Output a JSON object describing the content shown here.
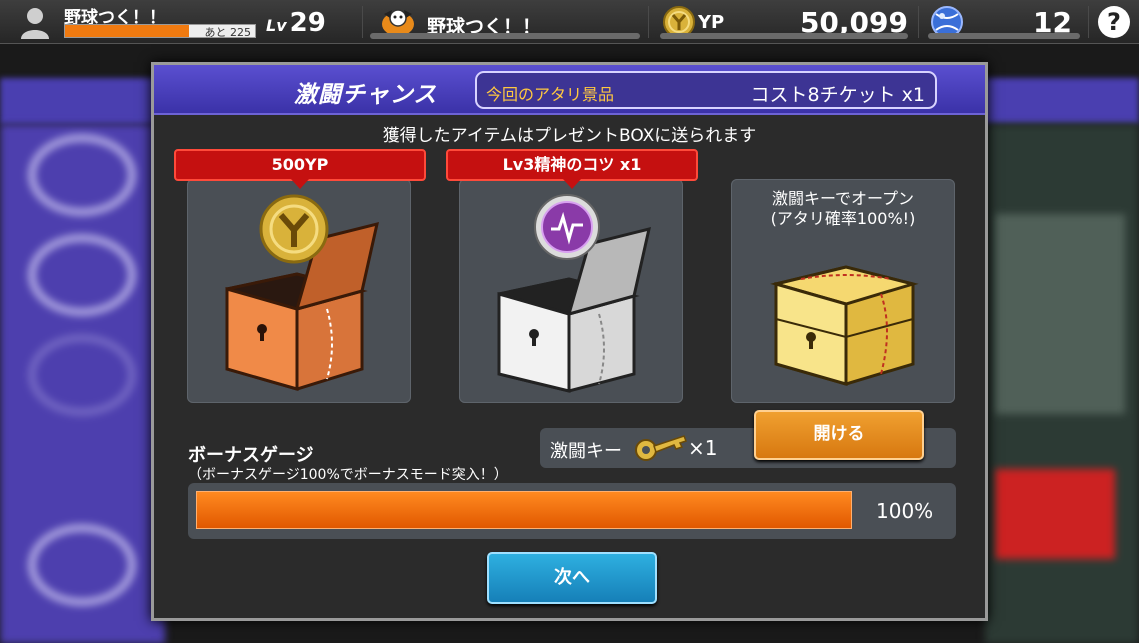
{
  "topbar": {
    "user_name": "野球つく！！",
    "exp_remaining": "あと 225",
    "exp_progress": 0.65,
    "level_prefix": "Lv",
    "level": "29",
    "team_name": "野球つく！！",
    "currency_label": "YP",
    "currency_value": "50,099",
    "ball_count": "12",
    "help_label": "?"
  },
  "modal": {
    "title": "激闘チャンス",
    "prize_label": "今回のアタリ景品",
    "prize_value": "コスト8チケット  x1",
    "notice": "獲得したアイテムはプレゼントBOXに送られます",
    "chests": [
      {
        "ribbon": "500YP",
        "color": "bronze",
        "icon": "yp-coin-icon"
      },
      {
        "ribbon": "Lv3精神のコツ  x1",
        "color": "silver",
        "icon": "mental-brain-icon"
      },
      {
        "caption_line1": "激闘キーでオープン",
        "caption_line2": "(アタリ確率100%!)",
        "color": "gold"
      }
    ],
    "key_label": "激闘キー",
    "key_count": "×1",
    "open_button": "開ける",
    "gauge_title": "ボーナスゲージ",
    "gauge_subtitle": "（ボーナスゲージ100%でボーナスモード突入！）",
    "gauge_percent": 100,
    "gauge_value": "100%",
    "next_button": "次へ"
  },
  "colors": {
    "header_purple": "#4a3fc0",
    "ribbon_red": "#c51010",
    "gauge_orange": "#f07010",
    "open_orange": "#e58a20",
    "next_blue": "#2196cc"
  }
}
